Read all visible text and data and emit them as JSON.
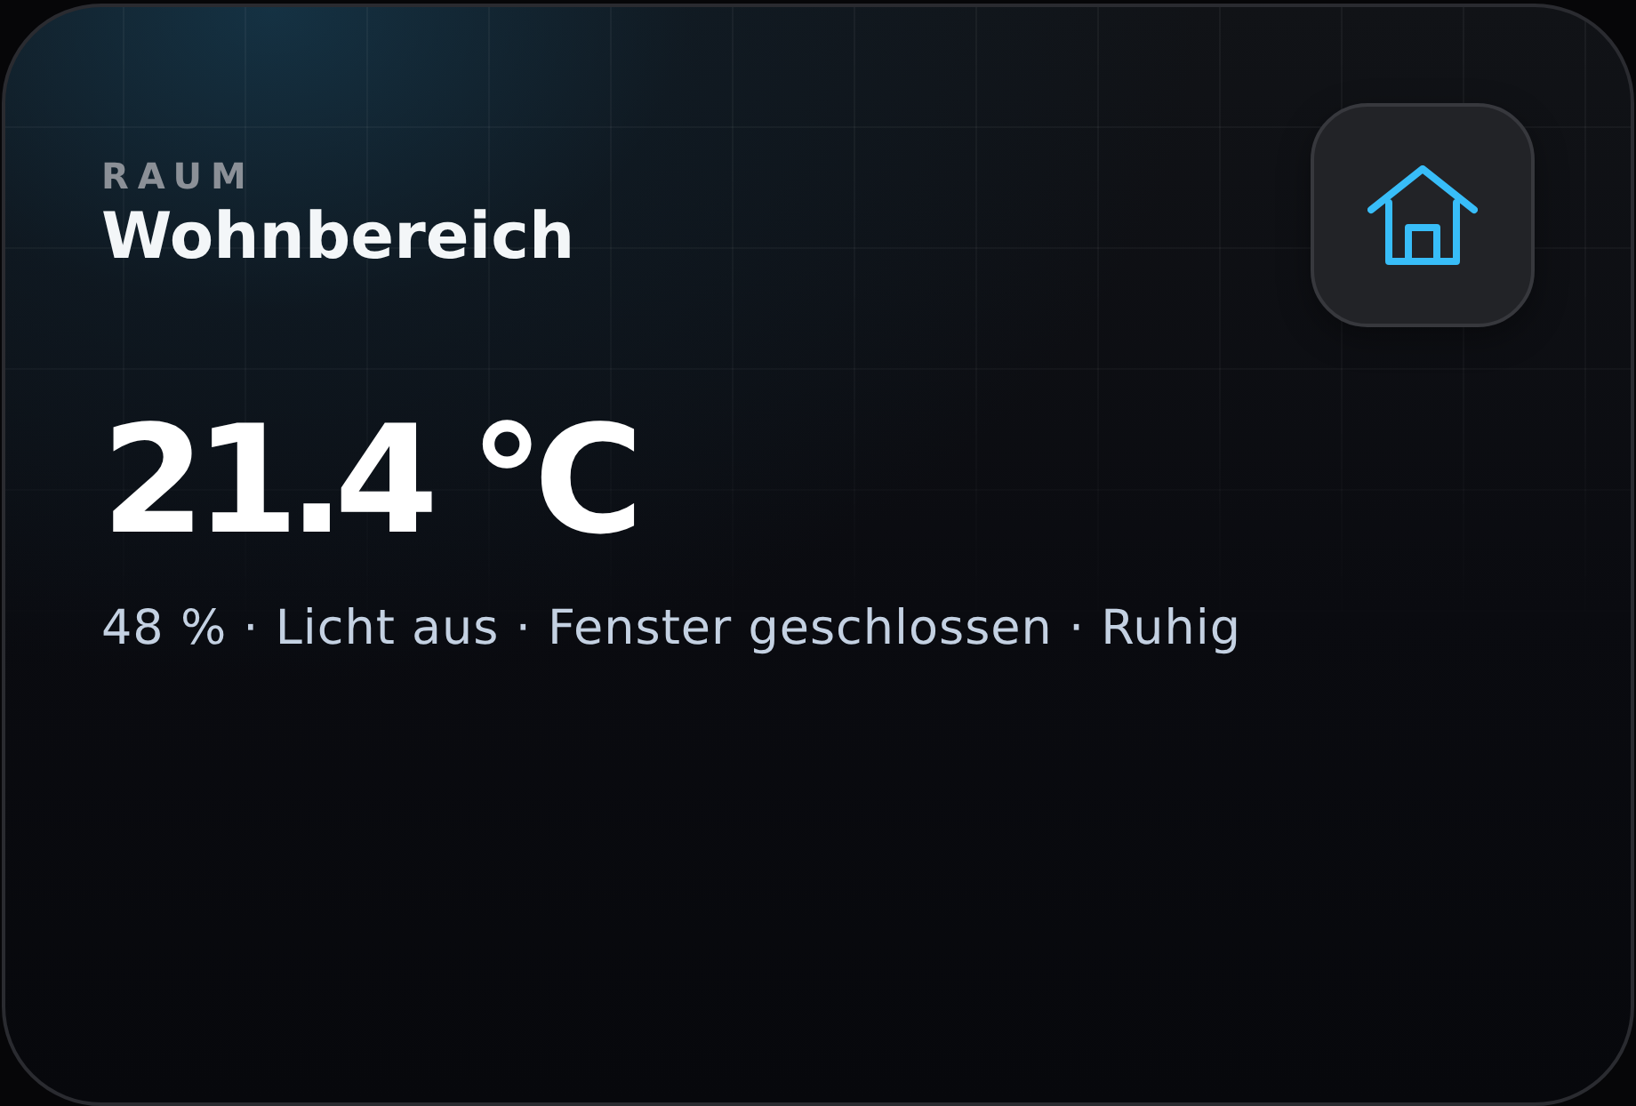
{
  "room": {
    "label": "RAUM",
    "name": "Wohnbereich"
  },
  "reading": {
    "temperature": "21.4 °C",
    "summary": "48 % · Licht aus · Fenster geschlossen · Ruhig"
  }
}
